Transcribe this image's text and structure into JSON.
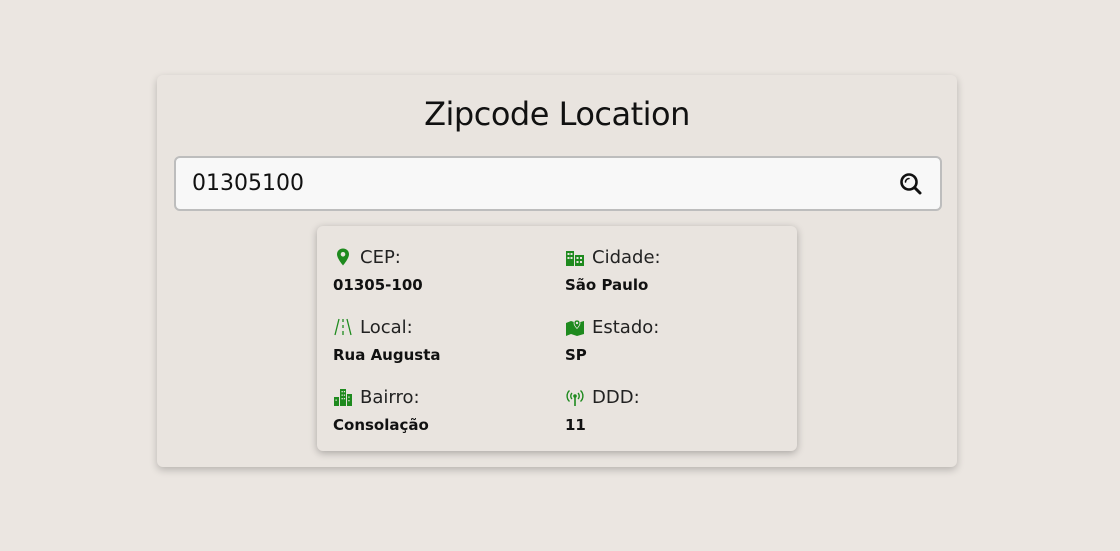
{
  "title": "Zipcode Location",
  "search": {
    "value": "01305100",
    "icon": "search-icon"
  },
  "accent_color": "#1e8a1e",
  "result": {
    "cep": {
      "label": "CEP:",
      "value": "01305-100",
      "icon": "map-pin-icon"
    },
    "cidade": {
      "label": "Cidade:",
      "value": "São Paulo",
      "icon": "city-icon"
    },
    "local": {
      "label": "Local:",
      "value": "Rua Augusta",
      "icon": "road-icon"
    },
    "estado": {
      "label": "Estado:",
      "value": "SP",
      "icon": "map-icon"
    },
    "bairro": {
      "label": "Bairro:",
      "value": "Consolação",
      "icon": "buildings-icon"
    },
    "ddd": {
      "label": "DDD:",
      "value": "11",
      "icon": "antenna-icon"
    }
  }
}
